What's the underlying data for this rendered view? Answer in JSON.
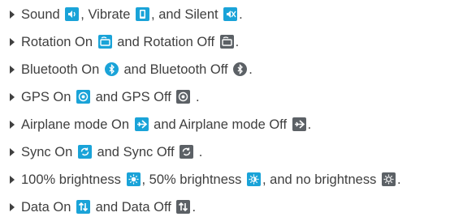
{
  "colors": {
    "icon_on": "#1aa3d8",
    "icon_off": "#5c6166",
    "bullet": "#404040",
    "text": "#3f3f3f"
  },
  "items": [
    {
      "parts": [
        "Sound ",
        ", Vibrate ",
        ", and Silent ",
        "."
      ],
      "icons": [
        "sound-icon",
        "vibrate-icon",
        "silent-icon"
      ]
    },
    {
      "parts": [
        "Rotation On ",
        " and Rotation Off ",
        "."
      ],
      "icons": [
        "rotation-on-icon",
        "rotation-off-icon"
      ]
    },
    {
      "parts": [
        "Bluetooth On ",
        " and Bluetooth Off ",
        "."
      ],
      "icons": [
        "bluetooth-on-icon",
        "bluetooth-off-icon"
      ]
    },
    {
      "parts": [
        "GPS On ",
        " and GPS Off ",
        " ."
      ],
      "icons": [
        "gps-on-icon",
        "gps-off-icon"
      ]
    },
    {
      "parts": [
        "Airplane mode On ",
        " and Airplane mode Off ",
        "."
      ],
      "icons": [
        "airplane-on-icon",
        "airplane-off-icon"
      ]
    },
    {
      "parts": [
        "Sync On ",
        " and Sync Off ",
        " ."
      ],
      "icons": [
        "sync-on-icon",
        "sync-off-icon"
      ]
    },
    {
      "parts": [
        "100% brightness ",
        ", 50% brightness ",
        ", and no brightness ",
        "."
      ],
      "icons": [
        "brightness-full-icon",
        "brightness-half-icon",
        "brightness-none-icon"
      ]
    },
    {
      "parts": [
        "Data On ",
        " and Data Off ",
        "."
      ],
      "icons": [
        "data-on-icon",
        "data-off-icon"
      ]
    }
  ]
}
